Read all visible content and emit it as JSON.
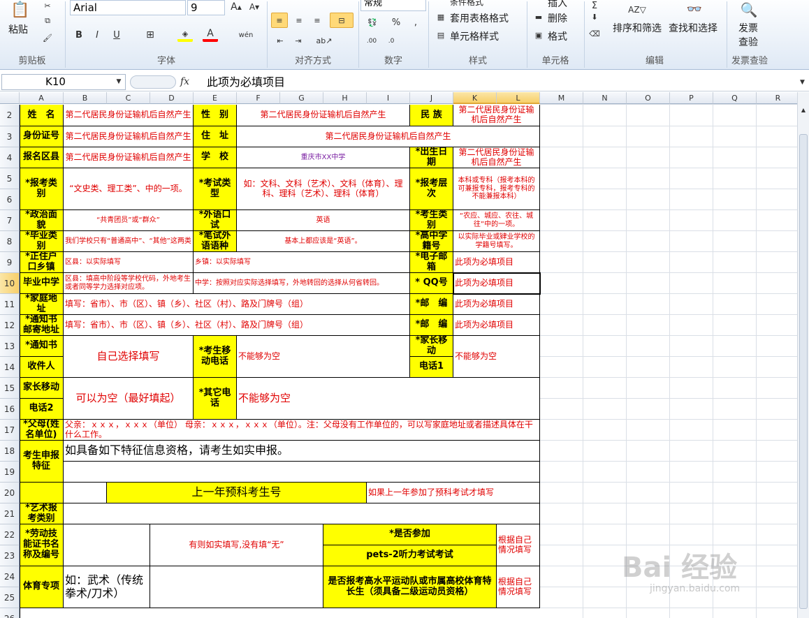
{
  "ribbon": {
    "paste_label": "粘贴",
    "font_name": "Arial",
    "font_size": "9",
    "number_format": "常规",
    "conditional_format": "条件格式",
    "table_format": "套用表格格式",
    "cell_style": "单元格样式",
    "insert": "插入",
    "delete": "删除",
    "format": "格式",
    "sort_filter": "排序和筛选",
    "find_select": "查找和选择",
    "invoice_check_1": "发票",
    "invoice_check_2": "查验",
    "groups": [
      "剪贴板",
      "字体",
      "对齐方式",
      "数字",
      "样式",
      "单元格",
      "编辑",
      "发票查验"
    ]
  },
  "formula_bar": {
    "name_box": "K10",
    "fx": "fx",
    "value": "此项为必填项目"
  },
  "columns": [
    "A",
    "B",
    "C",
    "D",
    "E",
    "F",
    "G",
    "H",
    "I",
    "J",
    "K",
    "L",
    "M",
    "N",
    "O",
    "P",
    "Q",
    "R"
  ],
  "rows": [
    "2",
    "3",
    "4",
    "5",
    "6",
    "7",
    "8",
    "9",
    "10",
    "11",
    "12",
    "13",
    "14",
    "15",
    "16",
    "17",
    "18",
    "19",
    "20",
    "21",
    "22",
    "23",
    "24",
    "25",
    "26"
  ],
  "cells": {
    "name_lbl": "姓　名",
    "name_val": "第二代居民身份证输机后自然产生",
    "sex_lbl": "性　别",
    "sex_val": "第二代居民身份证输机后自然产生",
    "nation_lbl": "民 族",
    "nation_val": "第二代居民身份证输机后自然产生",
    "id_lbl": "身份证号",
    "id_val": "第二代居民身份证输机后自然产生",
    "addr_lbl": "住　址",
    "addr_val": "第二代居民身份证输机后自然产生",
    "area_lbl": "报名区县",
    "area_val": "第二代居民身份证输机后自然产生",
    "school_lbl": "学　校",
    "school_val": "重庆市XX中学",
    "birth_lbl": "*出生日期",
    "birth_val": "第二代居民身份证输机后自然产生",
    "cat_lbl": "*报考类别",
    "cat_val": "“文史类、理工类”、中的一项。",
    "exam_lbl": "*考试类型",
    "exam_val": "如：文科、文科（艺术）、文科（体育）、理科、理科（艺术）、理科（体育）",
    "level_lbl": "*报考层次",
    "level_val": "本科或专科（报考本科的可兼报专科，报考专科的不能兼报本科）",
    "pol_lbl": "*政治面貌",
    "pol_val": "“共青团员”或“群众”",
    "oral_lbl": "*外语口试",
    "oral_val": "英语",
    "stype_lbl": "*考生类别",
    "stype_val": "“农应、城应、农往、城往”中的一项。",
    "grad_lbl": "*毕业类别",
    "grad_val": "我们学校只有“普通高中”、“其他”这两类",
    "written_lbl": "*笔试外语语种",
    "written_val": "基本上都应该是“英语”。",
    "hs_lbl": "*高中学籍号",
    "hs_val": "以实际毕业或肄业学校的学籍号填写。",
    "hukou_lbl": "*正住户口乡镇",
    "hukou_area": "区县：以实际填写",
    "hukou_town": "乡镇：以实际填写",
    "email_lbl": "*电子邮箱",
    "email_val": "此项为必填项目",
    "gradsch_lbl": "毕业中学",
    "gradsch_area": "区县：填高中阶段等学校代码，外地考生或者同等学力选择对应项。",
    "gradsch_sch": "中学：按照对应实际选择填写，外地转回的选择从何省转回。",
    "qq_lbl": "* QQ号",
    "qq_val": "此项为必填项目",
    "home_lbl": "*家庭地址",
    "home_val": "填写：省市）、市（区）、镇（乡）、社区（村）、路及门牌号（组）",
    "post1_lbl": "*邮　编",
    "post1_val": "此项为必填项目",
    "mail_lbl": "*通知书邮寄地址",
    "mail_val": "填写：省市）、市（区）、镇（乡）、社区（村）、路及门牌号（组）",
    "post2_lbl": "*邮　编",
    "post2_val": "此项为必填项目",
    "recv_lbl1": "*通知书",
    "recv_lbl2": "收件人",
    "recv_val": "自己选择填写",
    "smob_lbl": "*考生移动电话",
    "smob_val": "不能够为空",
    "pmob1_lbl1": "*家长移动",
    "pmob1_lbl2": "电话1",
    "pmob1_val": "不能够为空",
    "pmob2_lbl1": "家长移动",
    "pmob2_lbl2": "电话2",
    "pmob2_val": "可以为空（最好填起）",
    "other_lbl": "*其它电话",
    "other_val": "不能够为空",
    "parent_lbl": "*父母(姓名单位)",
    "parent_val": "父亲：ｘｘｘ，ｘｘｘ（单位） 母亲：ｘｘｘ，ｘｘｘ（单位）。注：父母没有工作单位的，可以写家庭地址或者描述具体在干什么工作。",
    "feat_lbl": "考生申报特征",
    "feat_val": "如具备如下特征信息资格，请考生如实申报。",
    "prev_lbl": "上一年预科考生号",
    "prev_val": "如果上一年参加了预科考试才填写",
    "art_lbl": "*艺术报考类别",
    "labor_lbl": "*劳动技能证书名称及编号",
    "labor_val": "有则如实填写,没有填“无”",
    "attend_lbl": "*是否参加",
    "pets_lbl": "pets-2听力考试考试",
    "self1": "根据自己情况填写",
    "sport_lbl": "体育专项",
    "sport_val": "如：武术（传统拳术/刀术）",
    "sport_q": "是否报考高水平运动队或市属高校体育特长生（须具备二级运动员资格）",
    "self2": "根据自己情况填写"
  },
  "watermark": {
    "main": "Bai 经验",
    "sub": "jingyan.baidu.com"
  }
}
